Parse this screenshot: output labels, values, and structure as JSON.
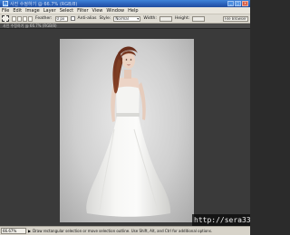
{
  "window": {
    "title": "사진 수정하기 @ 66.7% (RGB/8)",
    "buttons": {
      "minimize": "_",
      "maximize": "□",
      "close": "×"
    }
  },
  "menu": [
    "File",
    "Edit",
    "Image",
    "Layer",
    "Select",
    "Filter",
    "View",
    "Window",
    "Help"
  ],
  "options": {
    "feather_label": "Feather:",
    "feather_value": "0 px",
    "antialias_label": "Anti-alias",
    "style_label": "Style:",
    "style_value": "Normal",
    "width_label": "Width:",
    "height_label": "Height:",
    "palette_button": "File Browser"
  },
  "document": {
    "tab_title": "사진 수정하기 @ 66.7% (RGB/8)"
  },
  "status": {
    "zoom": "66.67%",
    "arrow": "▶",
    "hint": "Draw rectangular selection or move selection outline. Use Shift, Alt, and Ctrl for additional options."
  },
  "watermark": "http://sera33.tistory.com",
  "colors": {
    "accent": "#2a5fb8",
    "workspace": "#2a2a2a"
  }
}
